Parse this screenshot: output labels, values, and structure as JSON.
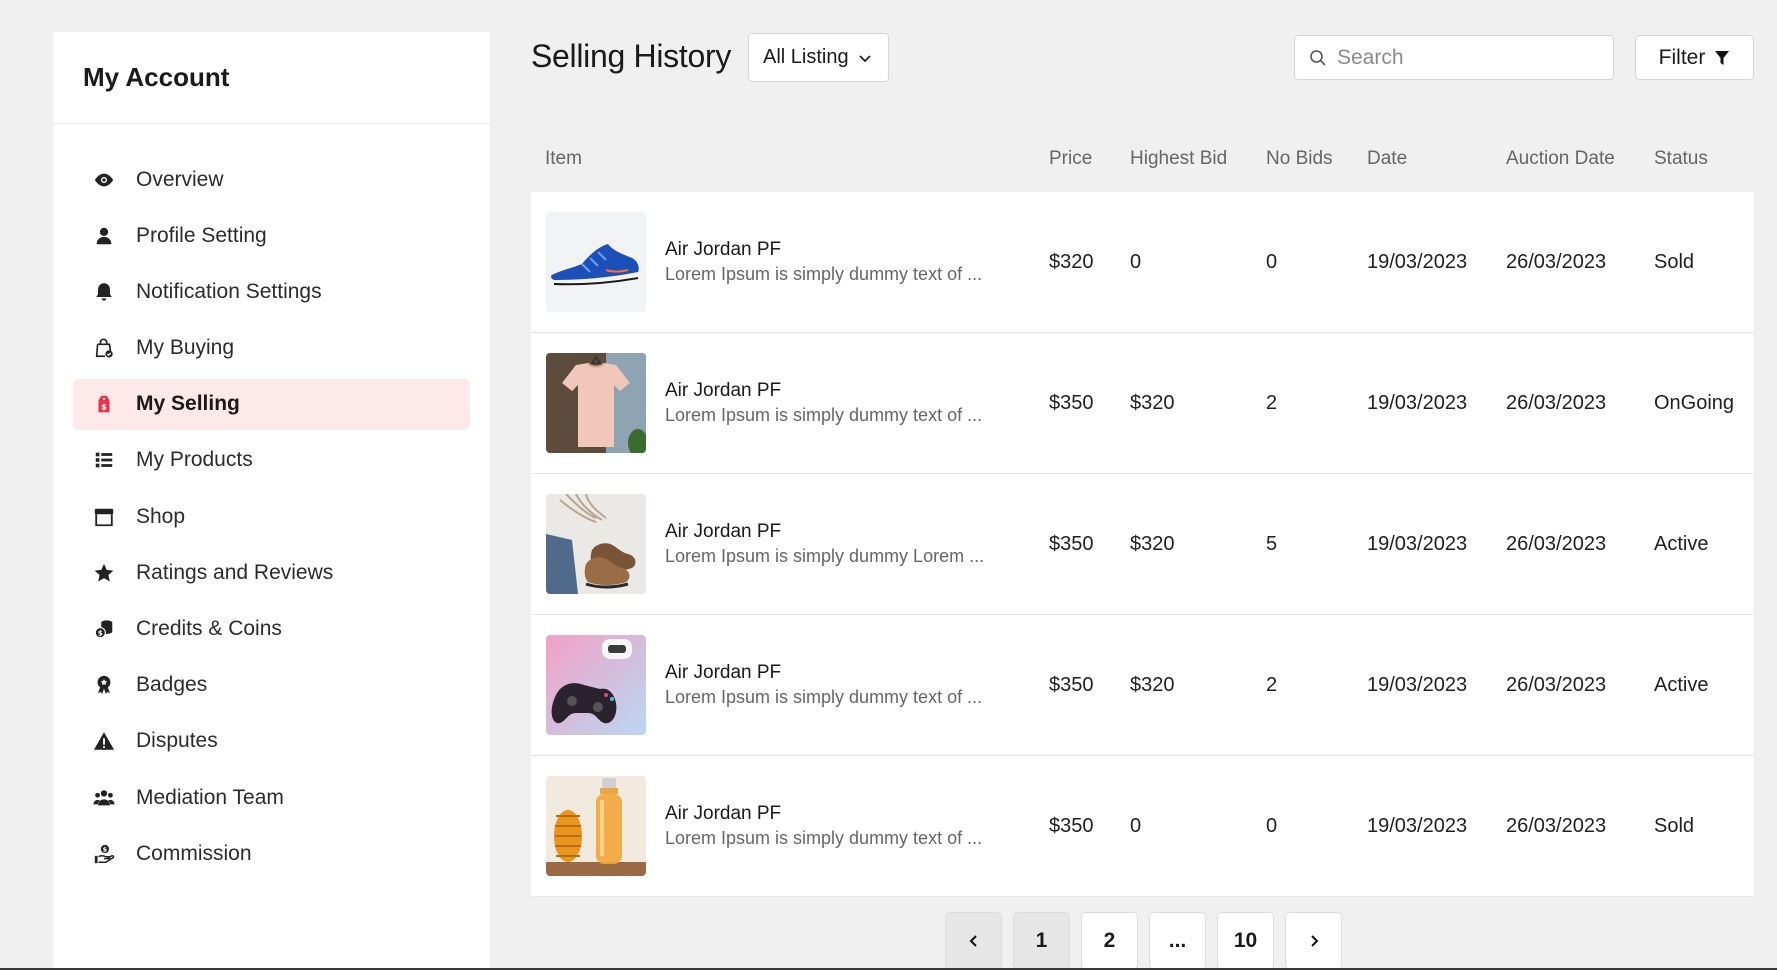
{
  "sidebar": {
    "title": "My Account",
    "items": [
      {
        "label": "Overview",
        "icon": "eye-icon",
        "active": false
      },
      {
        "label": "Profile Setting",
        "icon": "user-icon",
        "active": false
      },
      {
        "label": "Notification Settings",
        "icon": "bell-icon",
        "active": false
      },
      {
        "label": "My Buying",
        "icon": "shopping-bag-icon",
        "active": false
      },
      {
        "label": "My Selling",
        "icon": "price-tag-icon",
        "active": true
      },
      {
        "label": "My Products",
        "icon": "list-icon",
        "active": false
      },
      {
        "label": "Shop",
        "icon": "store-icon",
        "active": false
      },
      {
        "label": "Ratings and Reviews",
        "icon": "star-icon",
        "active": false
      },
      {
        "label": "Credits & Coins",
        "icon": "coins-icon",
        "active": false
      },
      {
        "label": "Badges",
        "icon": "badge-icon",
        "active": false
      },
      {
        "label": "Disputes",
        "icon": "warning-icon",
        "active": false
      },
      {
        "label": "Mediation Team",
        "icon": "team-icon",
        "active": false
      },
      {
        "label": "Commission",
        "icon": "commission-icon",
        "active": false
      }
    ]
  },
  "header": {
    "title": "Selling History",
    "listing_filter": "All Listing",
    "search_placeholder": "Search",
    "filter_label": "Filter"
  },
  "table": {
    "columns": [
      "Item",
      "Price",
      "Highest Bid",
      "No Bids",
      "Date",
      "Auction Date",
      "Status"
    ],
    "rows": [
      {
        "image": "blue-sneaker",
        "name": "Air Jordan PF",
        "desc": "Lorem Ipsum is simply dummy text of ...",
        "price": "$320",
        "highest_bid": "0",
        "no_bids": "0",
        "date": "19/03/2023",
        "auction_date": "26/03/2023",
        "status": "Sold"
      },
      {
        "image": "pink-tshirt",
        "name": "Air Jordan PF",
        "desc": "Lorem Ipsum is simply dummy text of ...",
        "price": "$350",
        "highest_bid": "$320",
        "no_bids": "2",
        "date": "19/03/2023",
        "auction_date": "26/03/2023",
        "status": "OnGoing"
      },
      {
        "image": "brown-boots",
        "name": "Air Jordan PF",
        "desc": "Lorem Ipsum is simply dummy Lorem ...",
        "price": "$350",
        "highest_bid": "$320",
        "no_bids": "5",
        "date": "19/03/2023",
        "auction_date": "26/03/2023",
        "status": "Active"
      },
      {
        "image": "game-controller",
        "name": "Air Jordan PF",
        "desc": "Lorem Ipsum is simply dummy text of ...",
        "price": "$350",
        "highest_bid": "$320",
        "no_bids": "2",
        "date": "19/03/2023",
        "auction_date": "26/03/2023",
        "status": "Active"
      },
      {
        "image": "water-bottle",
        "name": "Air Jordan PF",
        "desc": "Lorem Ipsum is simply dummy text of ...",
        "price": "$350",
        "highest_bid": "0",
        "no_bids": "0",
        "date": "19/03/2023",
        "auction_date": "26/03/2023",
        "status": "Sold"
      }
    ]
  },
  "pagination": {
    "pages": [
      "1",
      "2",
      "...",
      "10"
    ],
    "current": "1"
  },
  "colors": {
    "background": "#f0f0f0",
    "active_nav_bg": "#fde8ea",
    "accent_red": "#e8334a"
  }
}
